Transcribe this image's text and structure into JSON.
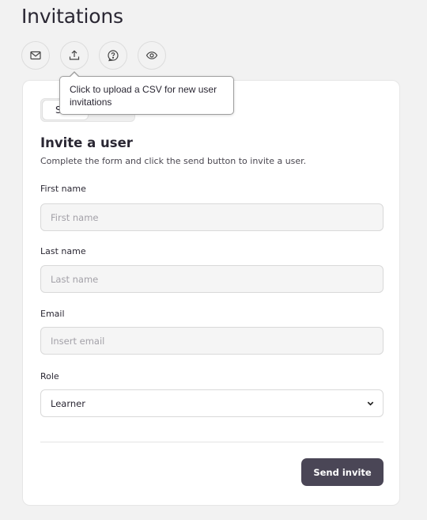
{
  "page": {
    "title": "Invitations"
  },
  "toolbar": {
    "icons": [
      {
        "name": "mail-icon"
      },
      {
        "name": "upload-icon"
      },
      {
        "name": "help-icon"
      },
      {
        "name": "eye-icon"
      }
    ]
  },
  "tooltip": {
    "text": "Click to upload a CSV for new user invitations"
  },
  "segmented": {
    "active_label": "S",
    "other_label": ""
  },
  "form": {
    "title": "Invite a user",
    "subtitle": "Complete the form and click the send button to invite a user.",
    "first_name": {
      "label": "First name",
      "placeholder": "First name",
      "value": ""
    },
    "last_name": {
      "label": "Last name",
      "placeholder": "Last name",
      "value": ""
    },
    "email": {
      "label": "Email",
      "placeholder": "Insert email",
      "value": ""
    },
    "role": {
      "label": "Role",
      "selected": "Learner"
    },
    "send_label": "Send invite"
  },
  "colors": {
    "background": "#f2f2f2",
    "card": "#ffffff",
    "primary_button": "#4a4656",
    "text": "#2a2733"
  }
}
